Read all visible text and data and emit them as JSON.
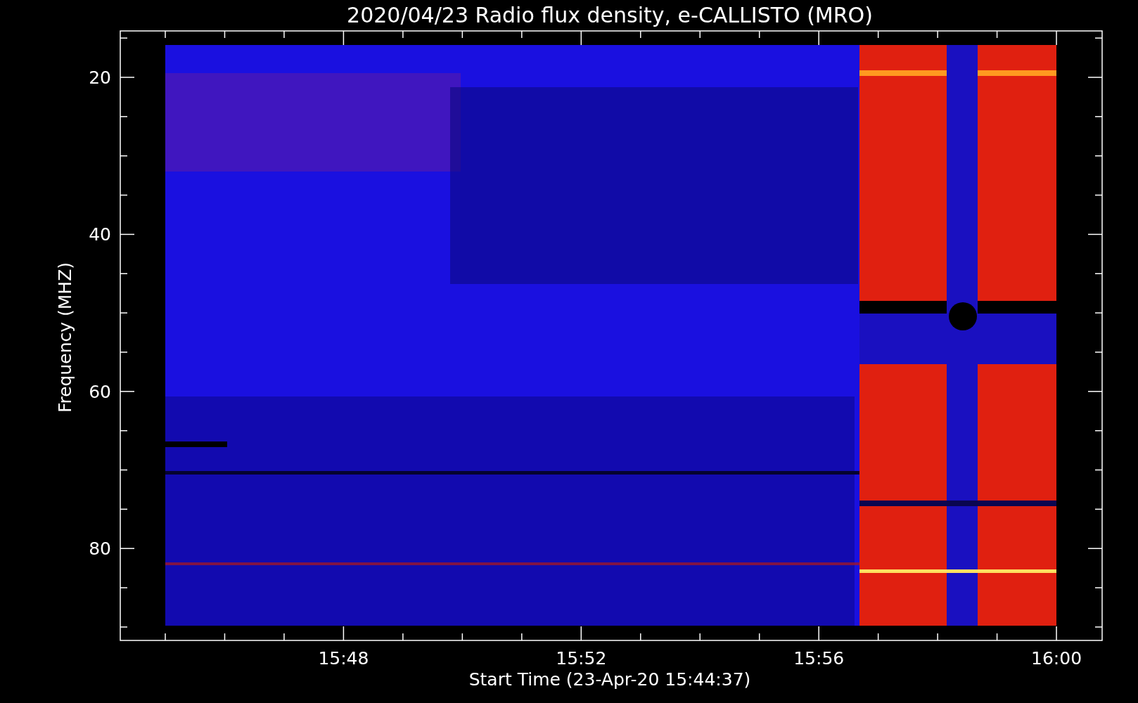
{
  "title": "2020/04/23  Radio flux density, e-CALLISTO (MRO)",
  "y_axis": {
    "label": "Frequency (MHZ)",
    "tick_labels": [
      "20",
      "40",
      "60",
      "80"
    ]
  },
  "x_axis": {
    "label": "Start Time (23-Apr-20 15:44:37)",
    "tick_labels": [
      "15:48",
      "15:52",
      "15:56",
      "16:00"
    ]
  }
}
